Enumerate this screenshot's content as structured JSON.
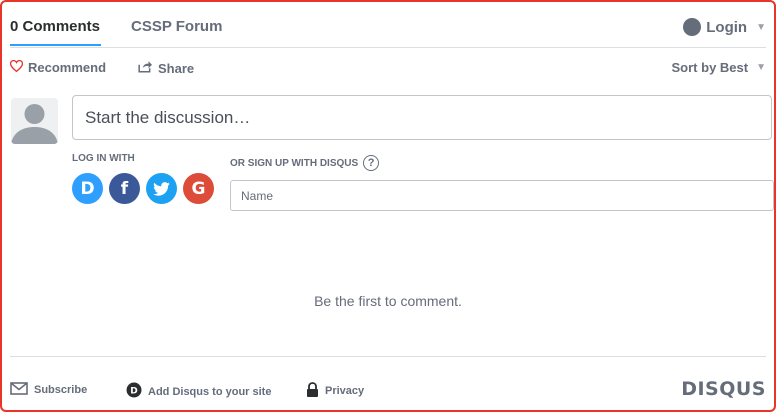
{
  "tabs": {
    "comments": "0 Comments",
    "forum": "CSSP Forum"
  },
  "header": {
    "login": "Login"
  },
  "actions": {
    "recommend": "Recommend",
    "share": "Share",
    "sort": "Sort by Best"
  },
  "composer": {
    "placeholder": "Start the discussion…",
    "login_with": "LOG IN WITH",
    "signup": "OR SIGN UP WITH DISQUS",
    "help": "?",
    "name_placeholder": "Name",
    "social": [
      "D",
      "f",
      "t",
      "G"
    ]
  },
  "empty_message": "Be the first to comment.",
  "footer": {
    "subscribe": "Subscribe",
    "add_disqus": "Add Disqus to your site",
    "privacy": "Privacy",
    "brand": "DISQUS"
  },
  "colors": {
    "accent": "#2e9fff",
    "frame": "#e8352a",
    "facebook": "#3b5998",
    "twitter": "#1da1f2",
    "google": "#dd4b39"
  }
}
